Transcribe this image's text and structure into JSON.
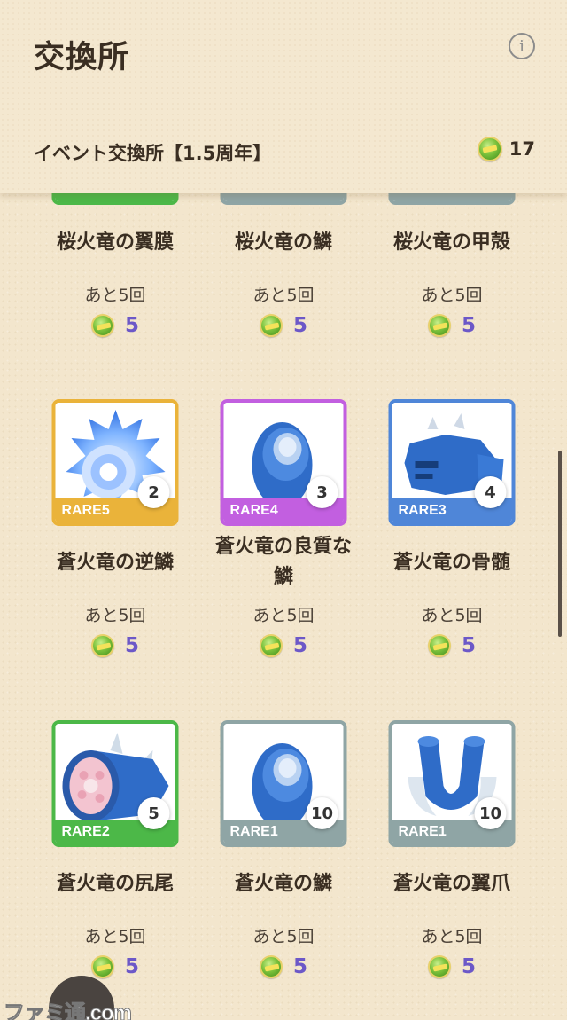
{
  "header": {
    "title": "交換所",
    "event_title": "イベント交換所【1.5周年】",
    "currency_count": "17",
    "info_icon": "info-icon",
    "currency_icon": "event-coin-icon"
  },
  "rarity_colors": {
    "RARE5": "#eab33a",
    "RARE4": "#c25fe0",
    "RARE3": "#4f86d8",
    "RARE2": "#4cb848",
    "RARE1": "#8fa5a5"
  },
  "items": [
    {
      "name": "桜火竜の翼膜",
      "remain": "あと5回",
      "cost": "5",
      "rare_color": "#4cb848"
    },
    {
      "name": "桜火竜の鱗",
      "remain": "あと5回",
      "cost": "5",
      "rare_color": "#8fa5a5"
    },
    {
      "name": "桜火竜の甲殻",
      "remain": "あと5回",
      "cost": "5",
      "rare_color": "#8fa5a5"
    },
    {
      "name": "蒼火竜の逆鱗",
      "remain": "あと5回",
      "cost": "5",
      "rare": "RARE5",
      "owned": "2",
      "rare_color": "#eab33a"
    },
    {
      "name": "蒼火竜の良質な鱗",
      "remain": "あと5回",
      "cost": "5",
      "rare": "RARE4",
      "owned": "3",
      "rare_color": "#c25fe0"
    },
    {
      "name": "蒼火竜の骨髄",
      "remain": "あと5回",
      "cost": "5",
      "rare": "RARE3",
      "owned": "4",
      "rare_color": "#4f86d8"
    },
    {
      "name": "蒼火竜の尻尾",
      "remain": "あと5回",
      "cost": "5",
      "rare": "RARE2",
      "owned": "5",
      "rare_color": "#4cb848"
    },
    {
      "name": "蒼火竜の鱗",
      "remain": "あと5回",
      "cost": "5",
      "rare": "RARE1",
      "owned": "10",
      "rare_color": "#8fa5a5"
    },
    {
      "name": "蒼火竜の翼爪",
      "remain": "あと5回",
      "cost": "5",
      "rare": "RARE1",
      "owned": "10",
      "rare_color": "#8fa5a5"
    }
  ],
  "watermark": "ファミ通.com"
}
